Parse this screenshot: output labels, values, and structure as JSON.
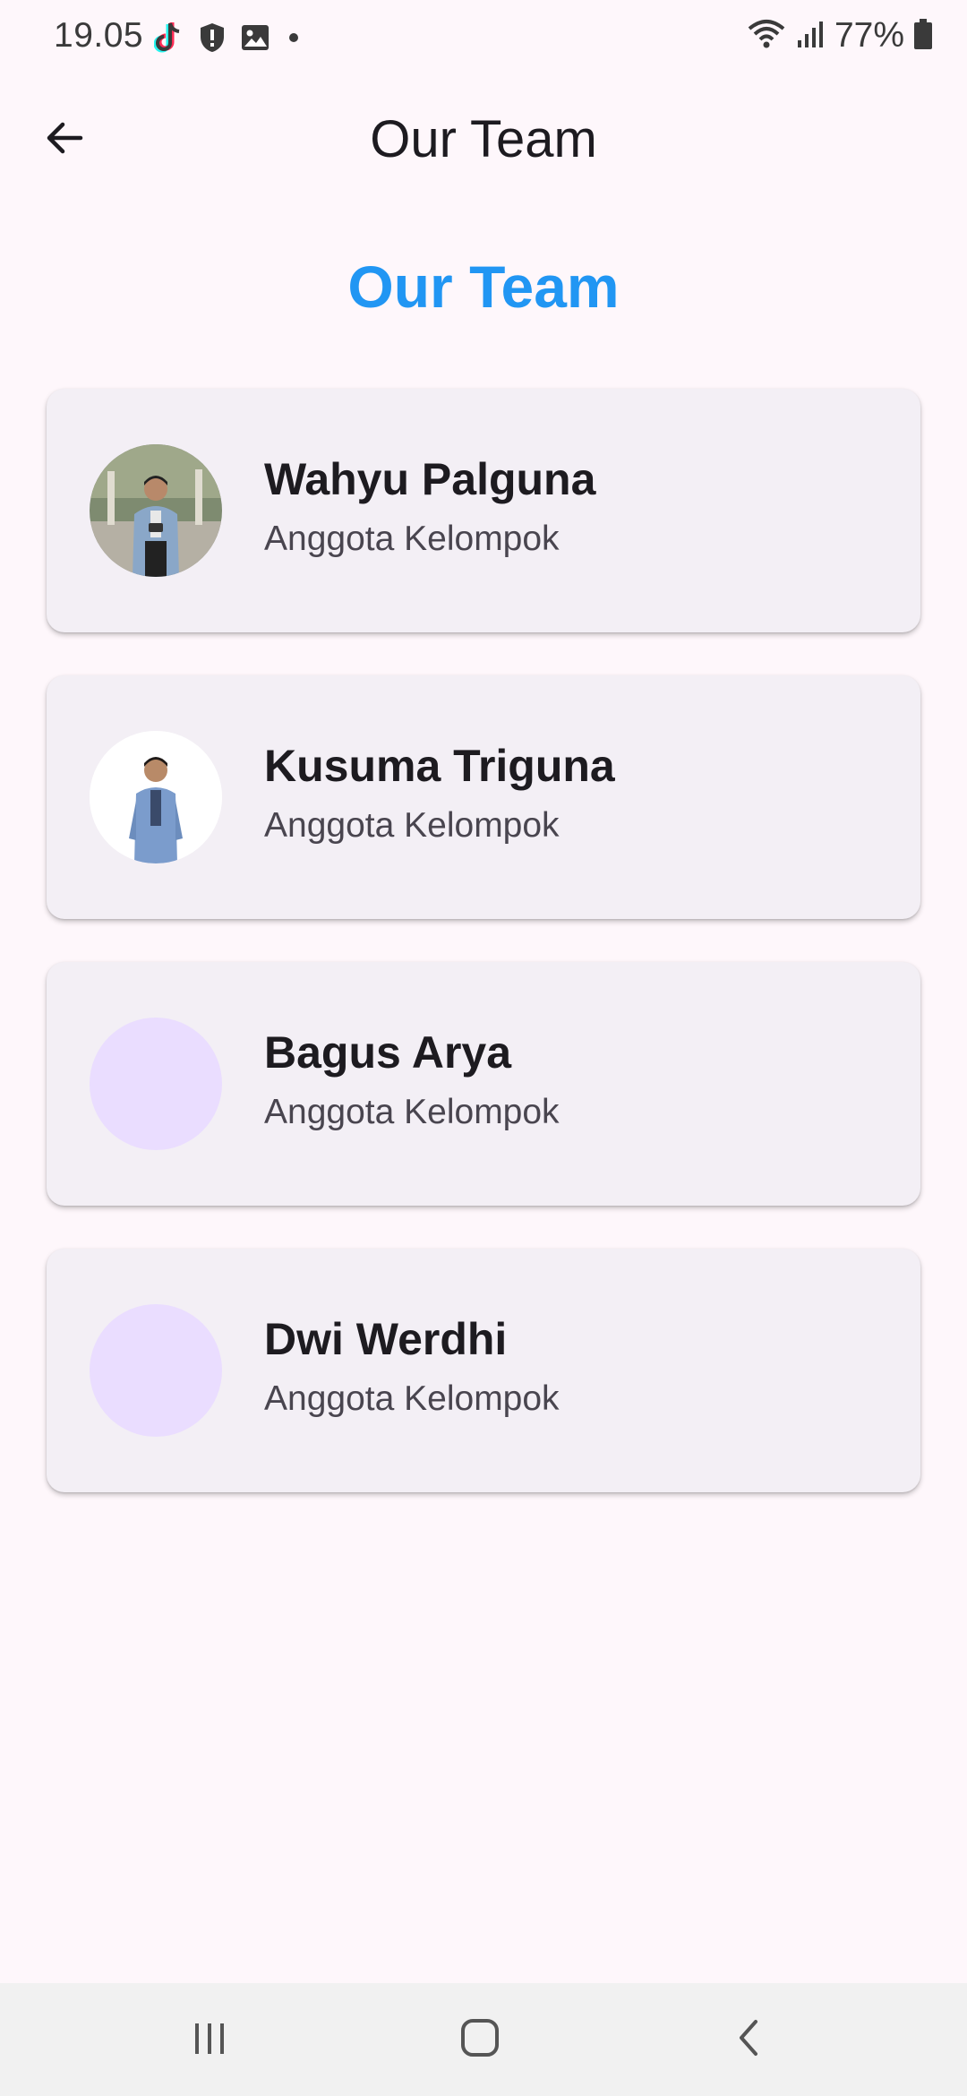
{
  "status_bar": {
    "time": "19.05",
    "battery_percent": "77%",
    "icons": [
      "tiktok-icon",
      "shield-alert-icon",
      "gallery-icon",
      "dot-icon",
      "wifi-icon",
      "signal-icon",
      "battery-icon"
    ]
  },
  "app_bar": {
    "title": "Our Team",
    "back_icon": "arrow-left-icon"
  },
  "heading": "Our Team",
  "colors": {
    "accent": "#2196f3",
    "background": "#fef7fb",
    "card": "#f3eff5",
    "avatar_placeholder": "#eaddff"
  },
  "members": [
    {
      "name": "Wahyu Palguna",
      "role": "Anggota Kelompok",
      "avatar": "photo"
    },
    {
      "name": "Kusuma Triguna",
      "role": "Anggota Kelompok",
      "avatar": "photo"
    },
    {
      "name": "Bagus Arya",
      "role": "Anggota Kelompok",
      "avatar": "placeholder"
    },
    {
      "name": "Dwi Werdhi",
      "role": "Anggota Kelompok",
      "avatar": "placeholder"
    }
  ],
  "nav_bar": {
    "buttons": [
      "recent-apps-icon",
      "home-icon",
      "back-icon"
    ]
  }
}
